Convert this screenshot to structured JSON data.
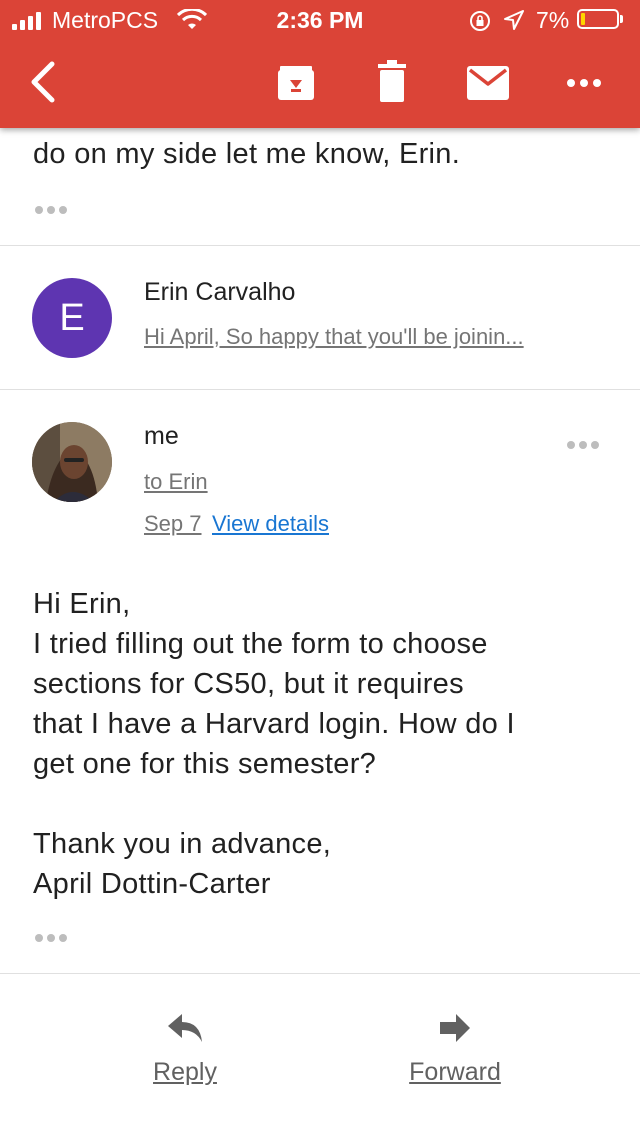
{
  "status_bar": {
    "carrier": "MetroPCS",
    "time": "2:36 PM",
    "battery_percent": "7%",
    "battery_level": 0.07
  },
  "toolbar": {
    "icons": [
      "back-icon",
      "archive-icon",
      "delete-icon",
      "mark-unread-icon",
      "more-icon"
    ],
    "accent_color": "#db4437"
  },
  "previous_message": {
    "tail_text": "do on my side let me know, Erin."
  },
  "collapsed_message": {
    "avatar_letter": "E",
    "avatar_color": "#5e35b1",
    "sender": "Erin Carvalho",
    "snippet": "Hi April, So happy that you'll be joinin..."
  },
  "expanded_message": {
    "sender": "me",
    "recipient": "to Erin",
    "date": "Sep 7",
    "view_details": "View details",
    "body": [
      "Hi Erin,",
      "I tried filling out the form to choose",
      "sections for CS50, but it requires",
      "that I have a Harvard login. How do I",
      "get one for this semester?",
      "",
      "Thank you in advance,",
      "April Dottin-Carter"
    ]
  },
  "actions": {
    "reply": "Reply",
    "forward": "Forward"
  }
}
